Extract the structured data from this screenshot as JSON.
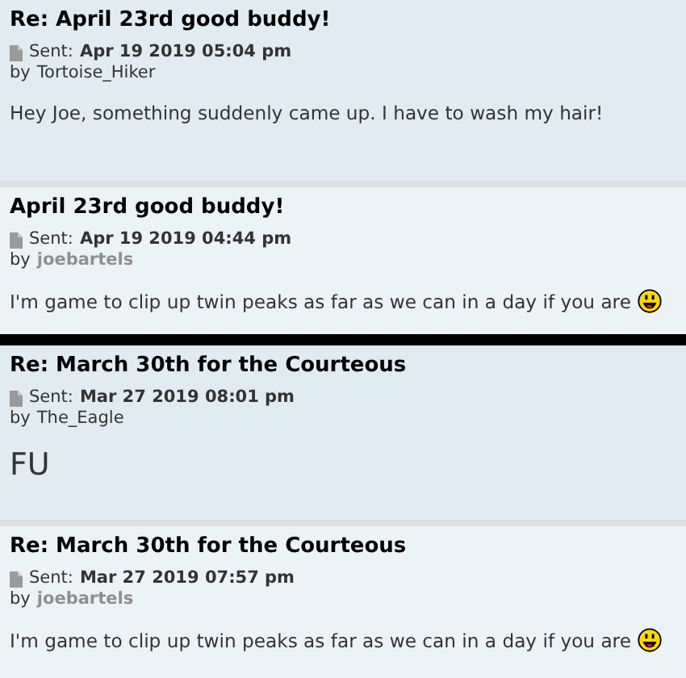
{
  "threads": [
    {
      "posts": [
        {
          "title": "Re: April 23rd good buddy!",
          "sent_label": "Sent:",
          "sent": "Apr 19 2019 05:04 pm",
          "by_label": "by",
          "author": "Tortoise_Hiker",
          "author_highlighted": false,
          "body": "Hey Joe, something suddenly came up. I have to wash my hair!",
          "body_large": false,
          "smiley": false
        },
        {
          "title": "April 23rd good buddy!",
          "sent_label": "Sent:",
          "sent": "Apr 19 2019 04:44 pm",
          "by_label": "by",
          "author": "joebartels",
          "author_highlighted": true,
          "body": "I'm game to clip up twin peaks as far as we can in a day if you are",
          "body_large": false,
          "smiley": true
        }
      ]
    },
    {
      "posts": [
        {
          "title": "Re: March 30th for the Courteous",
          "sent_label": "Sent:",
          "sent": "Mar 27 2019 08:01 pm",
          "by_label": "by",
          "author": "The_Eagle",
          "author_highlighted": false,
          "body": "FU",
          "body_large": true,
          "smiley": false
        },
        {
          "title": "Re: March 30th for the Courteous",
          "sent_label": "Sent:",
          "sent": "Mar 27 2019 07:57 pm",
          "by_label": "by",
          "author": "joebartels",
          "author_highlighted": true,
          "body": "I'm game to clip up twin peaks as far as we can in a day if you are",
          "body_large": false,
          "smiley": true
        }
      ]
    }
  ]
}
